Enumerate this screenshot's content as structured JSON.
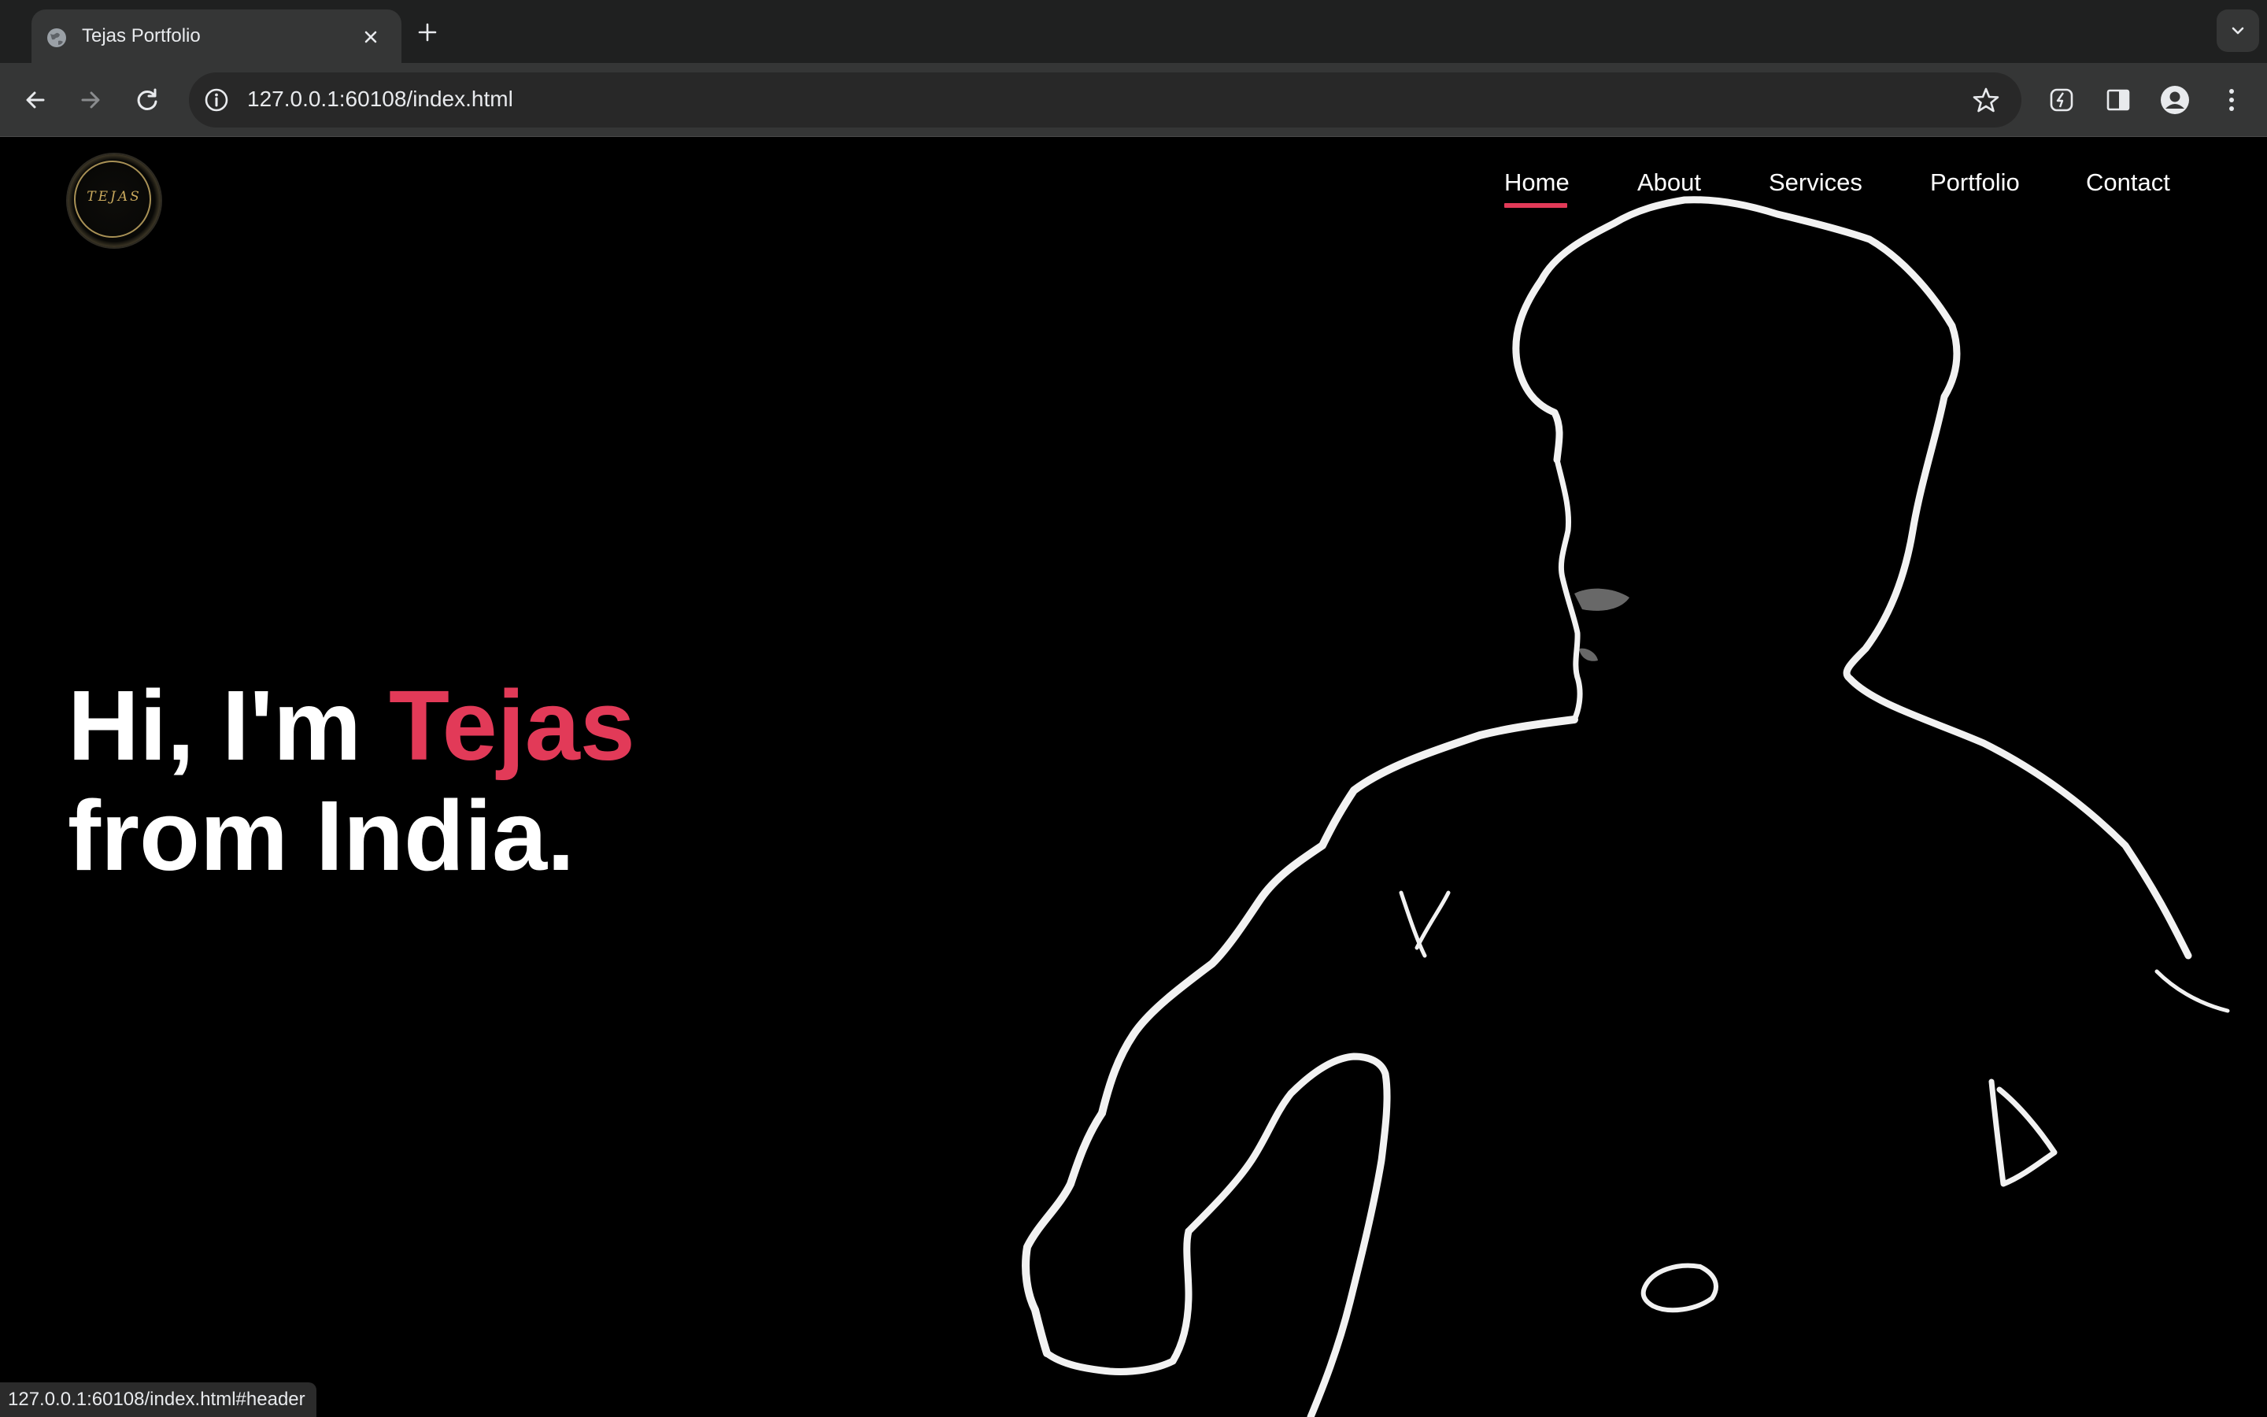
{
  "browser": {
    "tab_title": "Tejas Portfolio",
    "url": "127.0.0.1:60108/index.html",
    "status_url": "127.0.0.1:60108/index.html#header",
    "icons": [
      "globe-icon",
      "close-icon",
      "plus-icon",
      "chevron-down-icon",
      "back-arrow-icon",
      "forward-arrow-icon",
      "reload-icon",
      "site-info-icon",
      "star-icon",
      "extension-icon",
      "side-panel-icon",
      "profile-icon",
      "kebab-menu-icon"
    ]
  },
  "site": {
    "logo_text": "TEJAS",
    "nav": [
      {
        "label": "Home",
        "active": true
      },
      {
        "label": "About",
        "active": false
      },
      {
        "label": "Services",
        "active": false
      },
      {
        "label": "Portfolio",
        "active": false
      },
      {
        "label": "Contact",
        "active": false
      }
    ],
    "hero": {
      "line1_prefix": "Hi, I'm ",
      "line1_name": "Tejas",
      "line2": "from India."
    },
    "colors": {
      "accent": "#e23a58",
      "background": "#000000",
      "text": "#ffffff"
    }
  }
}
